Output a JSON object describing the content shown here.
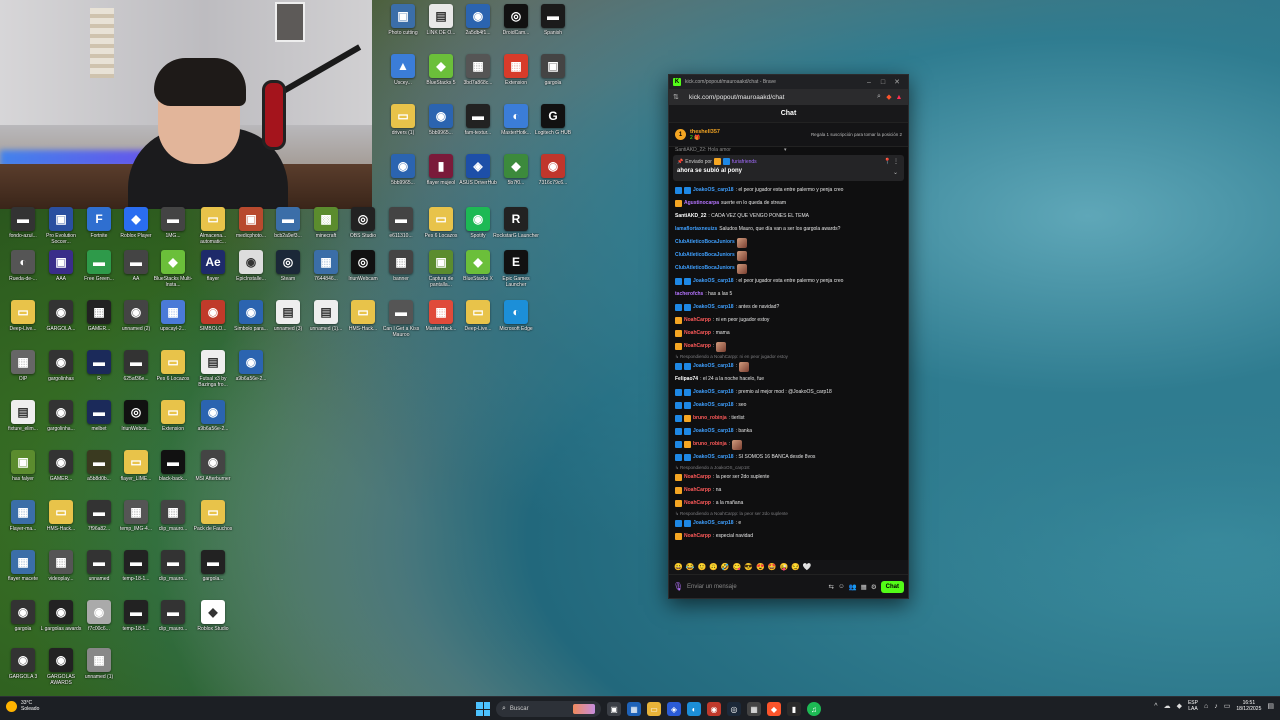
{
  "desktop_icons": [
    {
      "label": "Photo cutting",
      "color": "#3b6ea8",
      "glyph": "▣"
    },
    {
      "label": "LINK DE O...",
      "color": "#e8e8e8",
      "glyph": "▤"
    },
    {
      "label": "2a5db4f1...",
      "color": "#2b64b0",
      "glyph": "◉"
    },
    {
      "label": "DroidCam...",
      "color": "#111",
      "glyph": "◎"
    },
    {
      "label": "Spanish",
      "color": "#1b1b1b",
      "glyph": "▬"
    },
    {
      "label": "Uscey...",
      "color": "#3b7dd8",
      "glyph": "▲"
    },
    {
      "label": "BlueStacks 5",
      "color": "#6bbf3a",
      "glyph": "◆"
    },
    {
      "label": "3bd7a868c...",
      "color": "#555",
      "glyph": "▦"
    },
    {
      "label": "Extension",
      "color": "#d83b2a",
      "glyph": "▦"
    },
    {
      "label": "gargola",
      "color": "#444",
      "glyph": "▣"
    },
    {
      "label": "drivers (1)",
      "color": "#e8c34a",
      "glyph": "▭"
    },
    {
      "label": "5bb9965...",
      "color": "#2b64b0",
      "glyph": "◉"
    },
    {
      "label": "fam-textur...",
      "color": "#222",
      "glyph": "▬"
    },
    {
      "label": "MasterHotk...",
      "color": "#3b7dd8",
      "glyph": "◐"
    },
    {
      "label": "Logitech G HUB",
      "color": "#111",
      "glyph": "G"
    },
    {
      "label": "5bb9965...",
      "color": "#2b64b0",
      "glyph": "◉"
    },
    {
      "label": "flayer mujeol",
      "color": "#7a1a3a",
      "glyph": "▮"
    },
    {
      "label": "ASUS DriverHub",
      "color": "#1d4fa8",
      "glyph": "◈"
    },
    {
      "label": "5b7f0...",
      "color": "#3c8a3c",
      "glyph": "◆"
    },
    {
      "label": "7316c79c6...",
      "color": "#c0362c",
      "glyph": "◉"
    },
    {
      "label": "fondo-azul...",
      "color": "#333",
      "glyph": "▬"
    },
    {
      "label": "Pro Evolution Soccer...",
      "color": "#2a4fa0",
      "glyph": "▣"
    },
    {
      "label": "Fortnite",
      "color": "#2f6fd0",
      "glyph": "F"
    },
    {
      "label": "Roblox Player",
      "color": "#2a6df0",
      "glyph": "◆"
    },
    {
      "label": "1MG...",
      "color": "#444",
      "glyph": "▬"
    },
    {
      "label": "Almacena... automatic...",
      "color": "#e8c34a",
      "glyph": "▭"
    },
    {
      "label": "medicphoto...",
      "color": "#b84a2e",
      "glyph": "▣"
    },
    {
      "label": "bcb2a9ef3...",
      "color": "#3b6ea8",
      "glyph": "▬"
    },
    {
      "label": "minecraft",
      "color": "#5b8c2e",
      "glyph": "▩"
    },
    {
      "label": "OBS Studio",
      "color": "#222",
      "glyph": "◎"
    },
    {
      "label": "e611310...",
      "color": "#444",
      "glyph": "▬"
    },
    {
      "label": "Pes 6 Locazos",
      "color": "#e8c34a",
      "glyph": "▭"
    },
    {
      "label": "Spotify",
      "color": "#1db954",
      "glyph": "◉"
    },
    {
      "label": "RockstarG Launcher",
      "color": "#222",
      "glyph": "R"
    },
    {
      "label": "Rueda-de-...",
      "color": "#555",
      "glyph": "◐"
    },
    {
      "label": "AAA",
      "color": "#3a2d8a",
      "glyph": "▣"
    },
    {
      "label": "Free Green...",
      "color": "#2e9a4a",
      "glyph": "▬"
    },
    {
      "label": "AA",
      "color": "#444",
      "glyph": "▬"
    },
    {
      "label": "BlueStacks Multi-Insta...",
      "color": "#6bbf3a",
      "glyph": "◆"
    },
    {
      "label": "flayer",
      "color": "#1e2a6a",
      "glyph": "Ae"
    },
    {
      "label": "EpicInstalle...",
      "color": "#ddd",
      "glyph": "◉"
    },
    {
      "label": "Steam",
      "color": "#1b2838",
      "glyph": "◎"
    },
    {
      "label": "7644846...",
      "color": "#3b6ea8",
      "glyph": "▦"
    },
    {
      "label": "IriunWebcam",
      "color": "#111",
      "glyph": "◎"
    },
    {
      "label": "banner",
      "color": "#444",
      "glyph": "▦"
    },
    {
      "label": "Captura de pantalla...",
      "color": "#5b8c2e",
      "glyph": "▣"
    },
    {
      "label": "BlueStacks X",
      "color": "#6bbf3a",
      "glyph": "◆"
    },
    {
      "label": "Epic Games Launcher",
      "color": "#111",
      "glyph": "E"
    },
    {
      "label": "Deep-Live...",
      "color": "#e8c34a",
      "glyph": "▭"
    },
    {
      "label": "GARGOLA...",
      "color": "#333",
      "glyph": "◉"
    },
    {
      "label": "GAMER...",
      "color": "#222",
      "glyph": "▦"
    },
    {
      "label": "unnamed (2)",
      "color": "#444",
      "glyph": "◉"
    },
    {
      "label": "upscayl-2...",
      "color": "#4a7ad8",
      "glyph": "▦"
    },
    {
      "label": "SIMBOLO...",
      "color": "#c03a2a",
      "glyph": "◉"
    },
    {
      "label": "Simbolo para...",
      "color": "#2b64b0",
      "glyph": "◉"
    },
    {
      "label": "unnamed (3)",
      "color": "#eee",
      "glyph": "▤"
    },
    {
      "label": "unnamed (1)...",
      "color": "#eee",
      "glyph": "▤"
    },
    {
      "label": "HMS-Hack...",
      "color": "#e8c34a",
      "glyph": "▭"
    },
    {
      "label": "Can I Get a Kiss Mauroo",
      "color": "#555",
      "glyph": "▬"
    },
    {
      "label": "MasterHack...",
      "color": "#e04a3a",
      "glyph": "▦"
    },
    {
      "label": "Deep-Live...",
      "color": "#e8c34a",
      "glyph": "▭"
    },
    {
      "label": "Microsoft Edge",
      "color": "#1c8fd8",
      "glyph": "◐"
    },
    {
      "label": "OIP",
      "color": "#666",
      "glyph": "▦"
    },
    {
      "label": "gargolinhas",
      "color": "#333",
      "glyph": "◉"
    },
    {
      "label": "R",
      "color": "#1b2a5a",
      "glyph": "▬"
    },
    {
      "label": "625af36e...",
      "color": "#333",
      "glyph": "▬"
    },
    {
      "label": "Pes 6 Locazos",
      "color": "#e8c34a",
      "glyph": "▭"
    },
    {
      "label": "Futsal x3 by Bazinga fro...",
      "color": "#eee",
      "glyph": "▤"
    },
    {
      "label": "a9b6a56e-2...",
      "color": "#2b64b0",
      "glyph": "◉"
    },
    {
      "label": "fixture_elim...",
      "color": "#eee",
      "glyph": "▤"
    },
    {
      "label": "gargolinha...",
      "color": "#333",
      "glyph": "◉"
    },
    {
      "label": "melbet",
      "color": "#1b2a5a",
      "glyph": "▬"
    },
    {
      "label": "IriunWebca...",
      "color": "#111",
      "glyph": "◎"
    },
    {
      "label": "Extension",
      "color": "#e8c34a",
      "glyph": "▭"
    },
    {
      "label": "a9b6a56e-2...",
      "color": "#2b64b0",
      "glyph": "◉"
    },
    {
      "label": "has falyer",
      "color": "#5b8c2e",
      "glyph": "▣"
    },
    {
      "label": "GAMER...",
      "color": "#333",
      "glyph": "◉"
    },
    {
      "label": "a5b8d0b...",
      "color": "#3a3a20",
      "glyph": "▬"
    },
    {
      "label": "flayer_LIME...",
      "color": "#e8c34a",
      "glyph": "▭"
    },
    {
      "label": "black-back...",
      "color": "#111",
      "glyph": "▬"
    },
    {
      "label": "MSI Afterburner",
      "color": "#444",
      "glyph": "◉"
    },
    {
      "label": "Flayer-ma...",
      "color": "#3b6ea8",
      "glyph": "▦"
    },
    {
      "label": "HMS-Hack...",
      "color": "#e8c34a",
      "glyph": "▭"
    },
    {
      "label": "7f96a82...",
      "color": "#333",
      "glyph": "▬"
    },
    {
      "label": "temp_IMG-4...",
      "color": "#555",
      "glyph": "▦"
    },
    {
      "label": "clip_mauro...",
      "color": "#444",
      "glyph": "▦"
    },
    {
      "label": "Pack de Fauchos",
      "color": "#e8c34a",
      "glyph": "▭"
    },
    {
      "label": "flayer macete",
      "color": "#3b6ea8",
      "glyph": "▦"
    },
    {
      "label": "videoplay...",
      "color": "#555",
      "glyph": "▦"
    },
    {
      "label": "unnamed",
      "color": "#333",
      "glyph": "▬"
    },
    {
      "label": "temp-18-1...",
      "color": "#222",
      "glyph": "▬"
    },
    {
      "label": "clip_mauro...",
      "color": "#333",
      "glyph": "▬"
    },
    {
      "label": "gargola...",
      "color": "#222",
      "glyph": "▬"
    },
    {
      "label": "gargola",
      "color": "#333",
      "glyph": "◉"
    },
    {
      "label": "L gargolas awards",
      "color": "#222",
      "glyph": "◉"
    },
    {
      "label": "f7c00c6...",
      "color": "#aaa",
      "glyph": "◉"
    },
    {
      "label": "temp-18-1...",
      "color": "#222",
      "glyph": "▬"
    },
    {
      "label": "clip_mauro...",
      "color": "#333",
      "glyph": "▬"
    },
    {
      "label": "Roblox Studio",
      "color": "#fff",
      "glyph": "◆"
    },
    {
      "label": "GARGOLA 3",
      "color": "#333",
      "glyph": "◉"
    },
    {
      "label": "GARGOLAS AWARDS",
      "color": "#222",
      "glyph": "◉"
    },
    {
      "label": "unnamed (1)",
      "color": "#888",
      "glyph": "▦"
    }
  ],
  "browser": {
    "window_title": "kick.com/popout/mauroaakd/chat - Brave",
    "url": "kick.com/popout/mauroaakd/chat",
    "chat_title": "Chat",
    "gift": {
      "user": "theshell357",
      "count": "2 🎁",
      "text": "Regala 1 suscripción para tomar la posición 2"
    },
    "pinned_peek": "SantiAKD_22: Hola amor",
    "pinned": {
      "by_label": "Enviado por",
      "by_user": "furiafriends",
      "message": "ahora se subió al pony"
    },
    "messages": [
      {
        "badges": [
          "b-blue",
          "b-blue"
        ],
        "user": "JoakoOS_carp18",
        "uclass": "u-blue",
        "text": ": el peor jugador esta entre palermo y penja creo"
      },
      {
        "badges": [
          "b-orange"
        ],
        "user": "Agustinocarpa",
        "uclass": "u-purple",
        "text": " suerte en lo  queda de stream"
      },
      {
        "badges": [],
        "user": "SantiAKD_22",
        "uclass": "u-white",
        "text": ": CADA VEZ QUE VENGO PONES EL TEMA"
      },
      {
        "badges": [],
        "user": "lamaflortaxneuizs",
        "uclass": "u-blue",
        "text": " Saludos Mauro, que día van a ser los gargola awards?"
      },
      {
        "badges": [],
        "user": "ClubAtleticoBocaJuniors",
        "uclass": "u-blue",
        "text": "",
        "emote": true
      },
      {
        "badges": [],
        "user": "ClubAtleticoBocaJuniors",
        "uclass": "u-blue",
        "text": "",
        "emote": true
      },
      {
        "badges": [],
        "user": "ClubAtleticoBocaJuniors",
        "uclass": "u-blue",
        "text": "",
        "emote": true
      },
      {
        "badges": [
          "b-blue",
          "b-blue"
        ],
        "user": "JoakoOS_carp18",
        "uclass": "u-blue",
        "text": ": el peor jugador esta entre palermo y penja creo"
      },
      {
        "badges": [],
        "user": "tacherofchs",
        "uclass": "u-purple",
        "text": ": has a las 5"
      },
      {
        "badges": [
          "b-blue",
          "b-blue"
        ],
        "user": "JoakoOS_carp18",
        "uclass": "u-blue",
        "text": ": antes de navidad?"
      },
      {
        "badges": [
          "b-orange"
        ],
        "user": "NoahCarpp",
        "uclass": "u-red",
        "text": ": ni en peor jugador estoy"
      },
      {
        "badges": [
          "b-orange"
        ],
        "user": "NoahCarpp",
        "uclass": "u-red",
        "text": ": mama"
      },
      {
        "badges": [
          "b-orange"
        ],
        "user": "NoahCarpp",
        "uclass": "u-red",
        "text": ":",
        "emote": true
      },
      {
        "reply": true,
        "text": "↳ Respondiendo a NoahCarpp: ni en peor jugador estoy"
      },
      {
        "badges": [
          "b-blue",
          "b-blue"
        ],
        "user": "JoakoOS_carp18",
        "uclass": "u-blue",
        "text": ":",
        "emote": true
      },
      {
        "badges": [],
        "user": "Felipao74",
        "uclass": "u-white",
        "text": ": el 24 a la noche hacelo, fue"
      },
      {
        "badges": [
          "b-blue",
          "b-blue"
        ],
        "user": "JoakoOS_carp18",
        "uclass": "u-blue",
        "text": ": premio al mejor mod : @JoakoOS_carp18"
      },
      {
        "badges": [
          "b-blue",
          "b-blue"
        ],
        "user": "JoakoOS_carp18",
        "uclass": "u-blue",
        "text": ": seo"
      },
      {
        "badges": [
          "b-blue",
          "b-orange"
        ],
        "user": "bruno_robinja",
        "uclass": "u-red",
        "text": ": tierlist"
      },
      {
        "badges": [
          "b-blue",
          "b-blue"
        ],
        "user": "JoakoOS_carp18",
        "uclass": "u-blue",
        "text": ": banka"
      },
      {
        "badges": [
          "b-blue",
          "b-orange"
        ],
        "user": "bruno_robinja",
        "uclass": "u-red",
        "text": ":",
        "emote": true
      },
      {
        "badges": [
          "b-blue",
          "b-blue"
        ],
        "user": "JoakoOS_carp18",
        "uclass": "u-blue",
        "text": ": SI SOMOS 16 BANCA desde 8vos"
      },
      {
        "reply": true,
        "text": "↳ Respondiendo a JoakoOS_carp18:"
      },
      {
        "badges": [
          "b-orange"
        ],
        "user": "NoahCarpp",
        "uclass": "u-red",
        "text": ": la peor ser 2do suplente"
      },
      {
        "badges": [
          "b-orange"
        ],
        "user": "NoahCarpp",
        "uclass": "u-red",
        "text": ": na"
      },
      {
        "badges": [
          "b-orange"
        ],
        "user": "NoahCarpp",
        "uclass": "u-red",
        "text": ": a la mañana"
      },
      {
        "reply": true,
        "text": "↳ Respondiendo a NoahCarpp: la peor ser 2do suplente"
      },
      {
        "badges": [
          "b-blue",
          "b-blue"
        ],
        "user": "JoakoOS_carp18",
        "uclass": "u-blue",
        "text": ": e"
      },
      {
        "badges": [
          "b-orange"
        ],
        "user": "NoahCarpp",
        "uclass": "u-red",
        "text": ": especial navidad"
      }
    ],
    "emojis": [
      "😀",
      "😂",
      "🙂",
      "🙃",
      "🤣",
      "😋",
      "😎",
      "😍",
      "🤩",
      "😜",
      "😏",
      "🤍"
    ],
    "input_placeholder": "Enviar un mensaje",
    "send_label": "Chat"
  },
  "taskbar": {
    "temp": "33°C",
    "weather": "Soleado",
    "search_label": "Buscar",
    "lang_top": "ESP",
    "lang_bottom": "LAA",
    "time": "16:51",
    "date": "18/12/2025"
  }
}
